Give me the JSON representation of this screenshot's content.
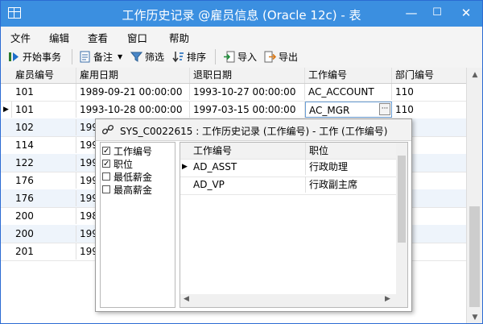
{
  "window": {
    "title": "工作历史记录 @雇员信息 (Oracle 12c) - 表",
    "minimize": "—",
    "maximize": "☐",
    "close": "✕"
  },
  "menu": [
    "文件",
    "编辑",
    "查看",
    "窗口",
    "帮助"
  ],
  "toolbar": {
    "begin_transaction": "开始事务",
    "memo": "备注",
    "filter": "筛选",
    "sort": "排序",
    "import": "导入",
    "export": "导出"
  },
  "grid": {
    "columns": [
      "雇员编号",
      "雇用日期",
      "退职日期",
      "工作编号",
      "部门编号"
    ],
    "rows": [
      [
        "101",
        "1989-09-21 00:00:00",
        "1993-10-27 00:00:00",
        "AC_ACCOUNT",
        "110"
      ],
      [
        "101",
        "1993-10-28 00:00:00",
        "1997-03-15 00:00:00",
        "AC_MGR",
        "110"
      ],
      [
        "102",
        "199",
        "",
        "",
        ""
      ],
      [
        "114",
        "199",
        "",
        "",
        ""
      ],
      [
        "122",
        "199",
        "",
        "",
        ""
      ],
      [
        "176",
        "199",
        "",
        "",
        ""
      ],
      [
        "176",
        "199",
        "",
        "",
        ""
      ],
      [
        "200",
        "198",
        "",
        "",
        ""
      ],
      [
        "200",
        "199",
        "",
        "",
        ""
      ],
      [
        "201",
        "199",
        "",
        "",
        ""
      ]
    ],
    "current_row_marker": "▶",
    "ellipsis": "···"
  },
  "lookup": {
    "title": "SYS_C0022615 : 工作历史记录 (工作编号) - 工作 (工作编号)",
    "fields": [
      {
        "label": "工作编号",
        "checked": true
      },
      {
        "label": "职位",
        "checked": true
      },
      {
        "label": "最低薪金",
        "checked": false
      },
      {
        "label": "最高薪金",
        "checked": false
      }
    ],
    "columns": [
      "工作编号",
      "职位"
    ],
    "rows": [
      [
        "AD_ASST",
        "行政助理"
      ],
      [
        "AD_VP",
        "行政副主席"
      ]
    ],
    "current_row_marker": "▶"
  }
}
